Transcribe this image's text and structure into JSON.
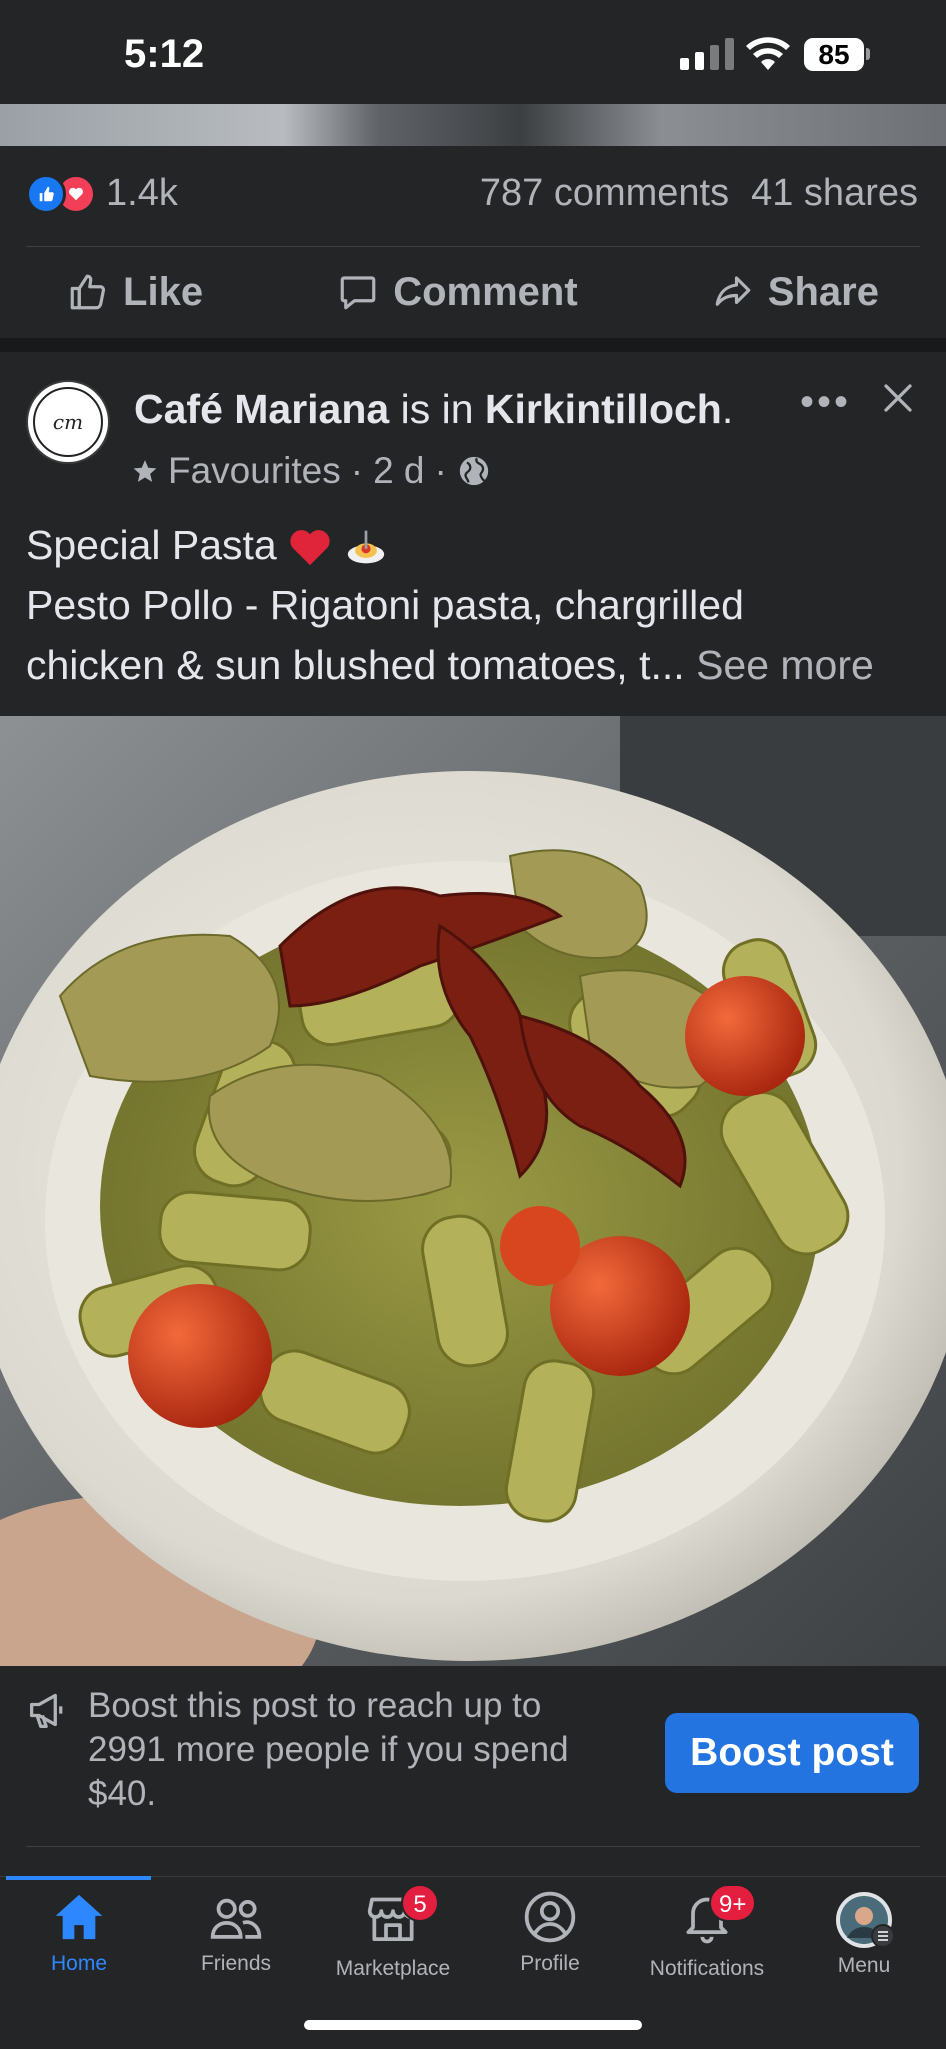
{
  "status_bar": {
    "time": "5:12",
    "battery": "85"
  },
  "post_stats": {
    "reaction_count": "1.4k",
    "comments": "787 comments",
    "shares": "41 shares"
  },
  "actions": {
    "like": "Like",
    "comment": "Comment",
    "share": "Share"
  },
  "post": {
    "page_name": "Café Mariana",
    "is_in": " is in ",
    "location": "Kirkintilloch",
    "location_suffix": ".",
    "audience": "Favourites",
    "time_ago": "2 d",
    "line1": "Special Pasta",
    "line2": "Pesto Pollo - Rigatoni pasta, chargrilled",
    "line3": "chicken & sun blushed tomatoes, t...",
    "see_more": "See more",
    "avatar_text": "cm"
  },
  "boost": {
    "text": "Boost this post to reach up to 2991 more people if you spend $40.",
    "button": "Boost post"
  },
  "tabs": [
    {
      "label": "Home",
      "active": true
    },
    {
      "label": "Friends"
    },
    {
      "label": "Marketplace",
      "badge": "5"
    },
    {
      "label": "Profile"
    },
    {
      "label": "Notifications",
      "badge": "9+"
    },
    {
      "label": "Menu"
    }
  ],
  "colors": {
    "accent": "#2d88ff",
    "button": "#2374e1",
    "badge": "#e41e3f",
    "background": "#242526"
  }
}
